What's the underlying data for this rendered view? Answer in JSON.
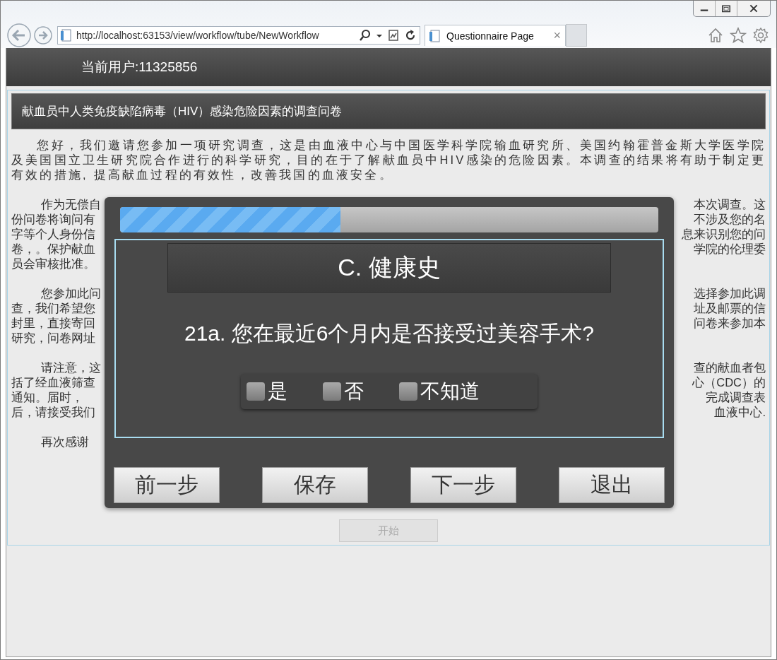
{
  "browser": {
    "address": "http://localhost:63153/view/workflow/tube/NewWorkflow",
    "tabs": [
      {
        "label": "Questionnaire Page",
        "close": "×",
        "selected": true
      }
    ]
  },
  "header": {
    "user_label": "当前用户:11325856"
  },
  "panel": {
    "title": "献血员中人类免疫缺陷病毒（HIV）感染危险因素的调查问卷",
    "intro": "您好，我们邀请您参加一项研究调查，这是由血液中心与中国医学科学院输血研究所、美国约翰霍普金斯大学医学院及美国国立卫生研究院合作进行的科学研究，目的在于了解献血员中HIV感染的危险因素。本调查的结果将有助于制定更有效的措施, 提高献血过程的有效性，改善我国的血液安全。",
    "covered_paragraphs": [
      [
        {
          "left": "作为无偿自",
          "right": "本次调查。这"
        },
        {
          "left": "份问卷将询问有",
          "right": "不涉及您的名"
        },
        {
          "left": "字等个人身份信",
          "right": "息来识别您的问"
        },
        {
          "left": "卷，。保护献血",
          "right": "学院的伦理委"
        },
        {
          "left": "员会审核批准。"
        }
      ],
      [
        {
          "left": "您参加此问",
          "right": "选择参加此调"
        },
        {
          "left": "查，我们希望您",
          "right": "址及邮票的信"
        },
        {
          "left": "封里，直接寄回",
          "right": "问卷来参加本"
        },
        {
          "left": "研究，问卷网址"
        }
      ],
      [
        {
          "left": "请注意，这",
          "right": "查的献血者包"
        },
        {
          "left": "括了经血液筛查",
          "right": "心（CDC）的"
        },
        {
          "left": "通知。届时，",
          "right": "完成调查表"
        },
        {
          "left": "后，请接受我们",
          "right": "血液中心."
        }
      ],
      [
        {
          "left": "再次感谢"
        }
      ]
    ],
    "start_button": {
      "label": "开始",
      "disabled": true
    }
  },
  "dialog": {
    "progress": {
      "level": 0.41
    },
    "section": "C. 健康史",
    "question": "21a. 您在最近6个月内是否接受过美容手术?",
    "options": [
      {
        "label": "是",
        "checked": false
      },
      {
        "label": "否",
        "checked": false
      },
      {
        "label": "不知道",
        "checked": false
      }
    ],
    "buttons": [
      "前一步",
      "保存",
      "下一步",
      "退出"
    ]
  }
}
